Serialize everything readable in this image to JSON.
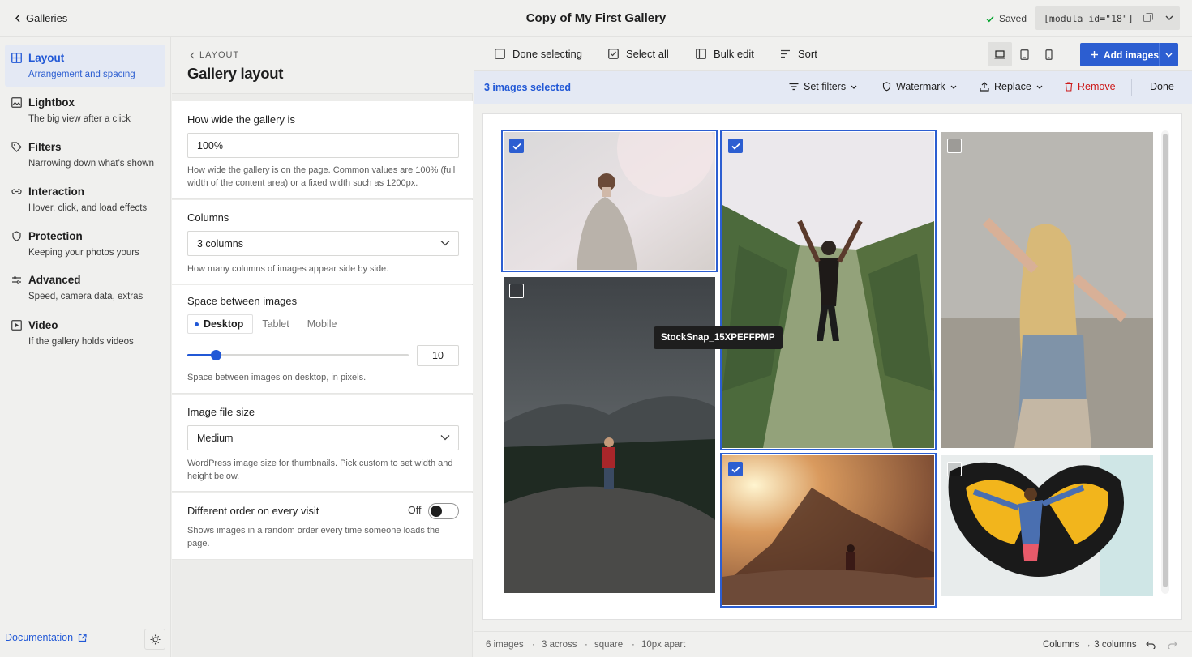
{
  "topbar": {
    "back_label": "Galleries",
    "title": "Copy of My First Gallery",
    "saved_label": "Saved",
    "shortcode": "[modula id=\"18\"]"
  },
  "nav": {
    "items": [
      {
        "label": "Layout",
        "desc": "Arrangement and spacing",
        "icon": "grid-icon",
        "active": true
      },
      {
        "label": "Lightbox",
        "desc": "The big view after a click",
        "icon": "image-icon"
      },
      {
        "label": "Filters",
        "desc": "Narrowing down what's shown",
        "icon": "tag-icon"
      },
      {
        "label": "Interaction",
        "desc": "Hover, click, and load effects",
        "icon": "link-icon"
      },
      {
        "label": "Protection",
        "desc": "Keeping your photos yours",
        "icon": "shield-icon"
      },
      {
        "label": "Advanced",
        "desc": "Speed, camera data, extras",
        "icon": "sliders-icon"
      },
      {
        "label": "Video",
        "desc": "If the gallery holds videos",
        "icon": "video-icon"
      }
    ],
    "doc_label": "Documentation"
  },
  "settings": {
    "crumb": "LAYOUT",
    "heading": "Gallery layout",
    "width": {
      "title": "How wide the gallery is",
      "value": "100%",
      "help": "How wide the gallery is on the page. Common values are 100% (full width of the content area) or a fixed width such as 1200px."
    },
    "columns": {
      "title": "Columns",
      "value": "3 columns",
      "help": "How many columns of images appear side by side."
    },
    "spacing": {
      "title": "Space between images",
      "tabs": [
        "Desktop",
        "Tablet",
        "Mobile"
      ],
      "active_tab": "Desktop",
      "value": "10",
      "slider_fraction": 0.13,
      "help": "Space between images on desktop, in pixels."
    },
    "filesize": {
      "title": "Image file size",
      "value": "Medium",
      "help": "WordPress image size for thumbnails. Pick custom to set width and height below."
    },
    "random": {
      "title": "Different order on every visit",
      "state_label": "Off",
      "help": "Shows images in a random order every time someone loads the page."
    }
  },
  "toolbar": {
    "done_selecting": "Done selecting",
    "select_all": "Select all",
    "bulk_edit": "Bulk edit",
    "sort": "Sort",
    "add_images": "Add images"
  },
  "selection": {
    "count_label": "3 images selected",
    "set_filters": "Set filters",
    "watermark": "Watermark",
    "replace": "Replace",
    "remove": "Remove",
    "done": "Done"
  },
  "gallery": {
    "tooltip": "StockSnap_15XPEFFPMP",
    "images": [
      {
        "name": "woman-in-fog",
        "selected": true
      },
      {
        "name": "yoga-in-vineyard",
        "selected": true
      },
      {
        "name": "blonde-arms-out",
        "selected": false
      },
      {
        "name": "hiker-on-cliff",
        "selected": false
      },
      {
        "name": "sunset-mountain",
        "selected": true
      },
      {
        "name": "mural-jump",
        "selected": false
      }
    ]
  },
  "statusbar": {
    "images": "6 images",
    "across": "3 across",
    "shape": "square",
    "apart": "10px apart",
    "sep": "·",
    "columns_info": "Columns → 3 columns"
  },
  "colors": {
    "accent": "#2c5ed1",
    "remove": "#cc1818",
    "selbar": "#e4e9f4"
  }
}
